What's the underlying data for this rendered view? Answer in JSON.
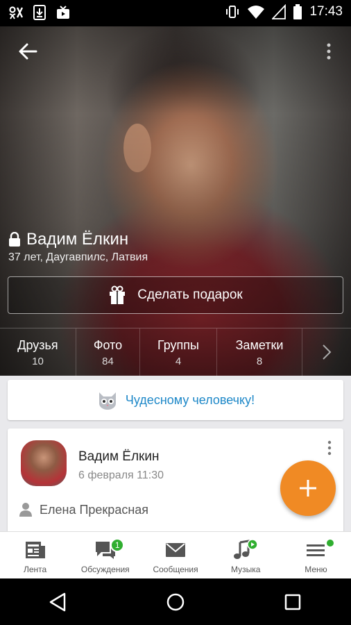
{
  "status_bar": {
    "time": "17:43",
    "icons": [
      "odnoklassniki-icon",
      "download-icon",
      "media-icon",
      "vibrate-icon",
      "wifi-icon",
      "signal-icon",
      "battery-icon"
    ]
  },
  "profile": {
    "name": "Вадим Ёлкин",
    "meta": "37 лет, Даугавпилс, Латвия",
    "gift_button": "Сделать подарок"
  },
  "stats": [
    {
      "label": "Друзья",
      "value": "10"
    },
    {
      "label": "Фото",
      "value": "84"
    },
    {
      "label": "Группы",
      "value": "4"
    },
    {
      "label": "Заметки",
      "value": "8"
    }
  ],
  "mood": {
    "text": "Чудесному человечку!"
  },
  "post": {
    "author": "Вадим Ёлкин",
    "date": "6 февраля 11:30",
    "with_user": "Елена Прекрасная"
  },
  "tabs": [
    {
      "label": "Лента",
      "icon": "feed-icon"
    },
    {
      "label": "Обсуждения",
      "icon": "discussions-icon",
      "badge": "1"
    },
    {
      "label": "Сообщения",
      "icon": "messages-icon"
    },
    {
      "label": "Музыка",
      "icon": "music-icon"
    },
    {
      "label": "Меню",
      "icon": "menu-icon"
    }
  ],
  "colors": {
    "accent_orange": "#f08a24",
    "link_blue": "#1e88c8",
    "badge_green": "#2fae2f"
  }
}
